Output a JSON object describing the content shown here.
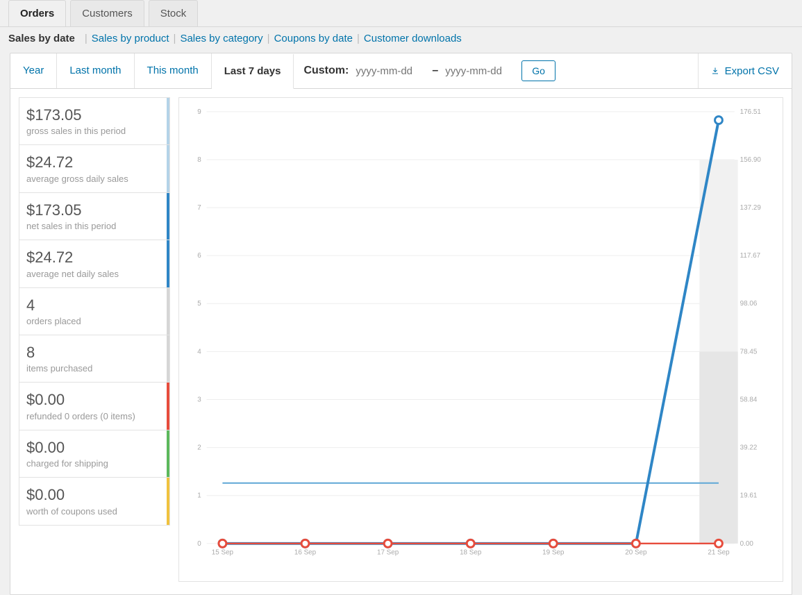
{
  "top_tabs": {
    "orders": "Orders",
    "customers": "Customers",
    "stock": "Stock"
  },
  "subnav": {
    "current": "Sales by date",
    "links": [
      "Sales by product",
      "Sales by category",
      "Coupons by date",
      "Customer downloads"
    ]
  },
  "period_tabs": {
    "year": "Year",
    "last_month": "Last month",
    "this_month": "This month",
    "last_7": "Last 7 days"
  },
  "custom": {
    "label": "Custom:",
    "placeholder": "yyyy-mm-dd",
    "go": "Go"
  },
  "export": "Export CSV",
  "stats": [
    {
      "value": "$173.05",
      "label": "gross sales in this period",
      "edge": "#b4d3e8"
    },
    {
      "value": "$24.72",
      "label": "average gross daily sales",
      "edge": "#b4d3e8"
    },
    {
      "value": "$173.05",
      "label": "net sales in this period",
      "edge": "#2f86c6"
    },
    {
      "value": "$24.72",
      "label": "average net daily sales",
      "edge": "#2f86c6"
    },
    {
      "value": "4",
      "label": "orders placed",
      "edge": "#d6d6d6"
    },
    {
      "value": "8",
      "label": "items purchased",
      "edge": "#d6d6d6"
    },
    {
      "value": "$0.00",
      "label": "refunded 0 orders (0 items)",
      "edge": "#e74c3c"
    },
    {
      "value": "$0.00",
      "label": "charged for shipping",
      "edge": "#5cb85c"
    },
    {
      "value": "$0.00",
      "label": "worth of coupons used",
      "edge": "#f0c23e"
    }
  ],
  "chart_data": {
    "type": "line",
    "x_categories": [
      "15 Sep",
      "16 Sep",
      "17 Sep",
      "18 Sep",
      "19 Sep",
      "20 Sep",
      "21 Sep"
    ],
    "left_axis": {
      "ticks": [
        0,
        1,
        2,
        3,
        4,
        5,
        6,
        7,
        8,
        9
      ]
    },
    "right_axis": {
      "ticks": [
        0.0,
        19.61,
        39.22,
        58.84,
        78.45,
        98.06,
        117.67,
        137.29,
        156.9,
        176.51
      ]
    },
    "series": [
      {
        "name": "items_purchased",
        "color": "#d6d6d6",
        "axis": "left",
        "type": "bar",
        "values": [
          0,
          0,
          0,
          0,
          0,
          0,
          8
        ]
      },
      {
        "name": "orders_placed",
        "color": "#d6d6d6",
        "axis": "left",
        "type": "bar",
        "values": [
          0,
          0,
          0,
          0,
          0,
          0,
          4
        ]
      },
      {
        "name": "average_sales",
        "color": "#5ea7d6",
        "axis": "right",
        "type": "line",
        "values": [
          24.72,
          24.72,
          24.72,
          24.72,
          24.72,
          24.72,
          24.72
        ]
      },
      {
        "name": "sales_amount",
        "color": "#2f86c6",
        "axis": "right",
        "type": "line",
        "values": [
          0,
          0,
          0,
          0,
          0,
          0,
          173.05
        ]
      },
      {
        "name": "refund_shipping_coupons",
        "color": "#e74c3c",
        "axis": "right",
        "type": "line",
        "values": [
          0,
          0,
          0,
          0,
          0,
          0,
          0
        ]
      }
    ]
  }
}
